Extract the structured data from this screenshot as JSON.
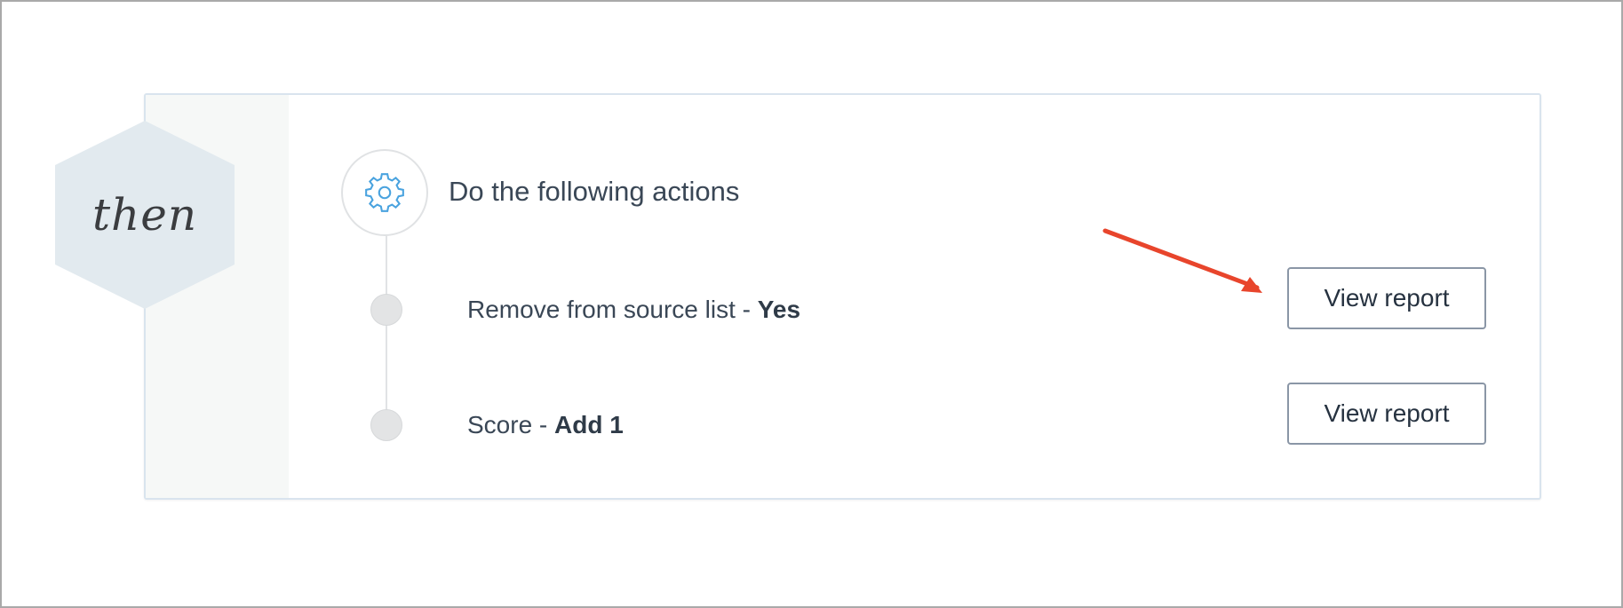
{
  "block": {
    "badge_label": "then",
    "heading": "Do the following actions",
    "accent_color": "#4aa3df",
    "annotation_arrow_color": "#e8452c"
  },
  "actions": [
    {
      "label": "Remove from source list - ",
      "value": "Yes",
      "button_label": "View report"
    },
    {
      "label": "Score - ",
      "value": "Add 1",
      "button_label": "View report"
    }
  ],
  "icons": {
    "header_icon": "gear-icon"
  }
}
